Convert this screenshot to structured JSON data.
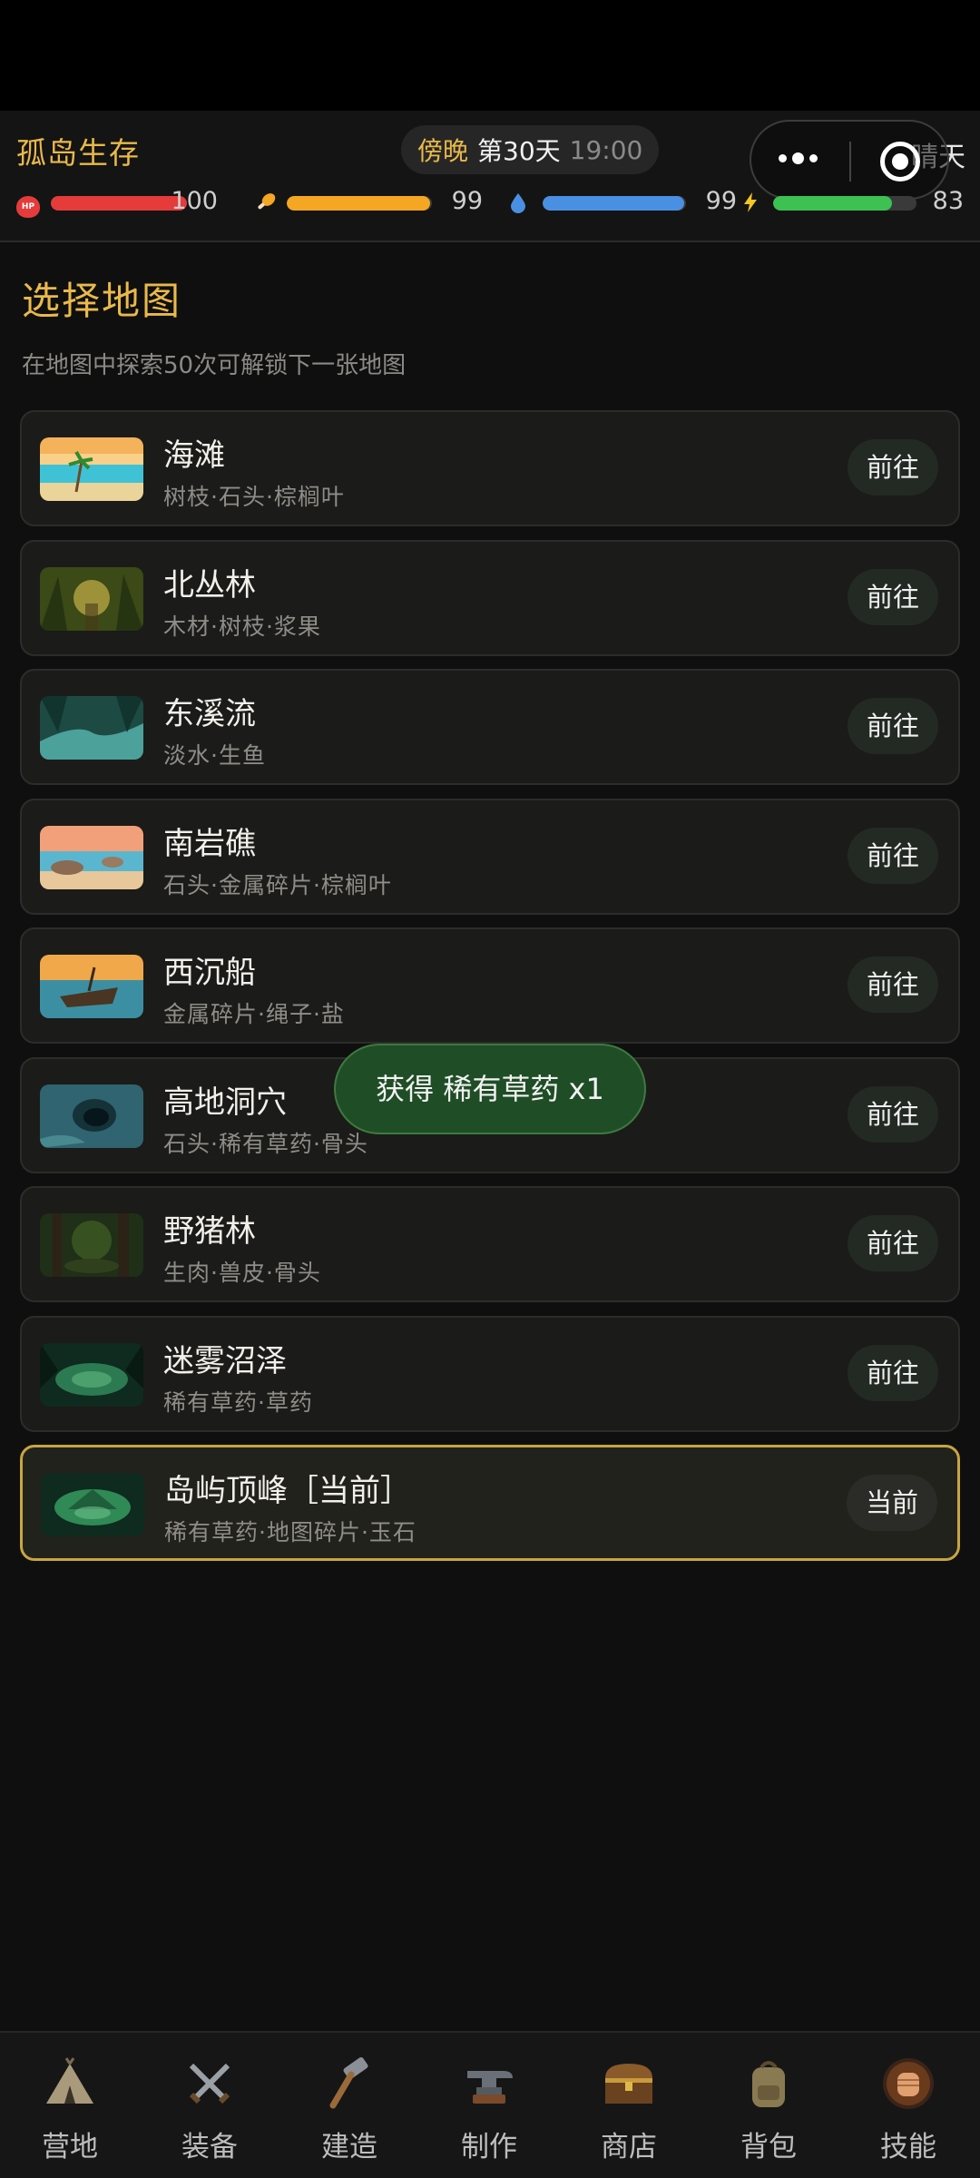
{
  "app": {
    "title": "孤岛生存"
  },
  "time": {
    "period": "傍晚",
    "day": "第30天",
    "clock": "19:00"
  },
  "weather": "晴天",
  "stats": {
    "hp": {
      "icon": "heart-hp-icon",
      "value": 100,
      "max": 100,
      "color": "#e53b3b"
    },
    "hunger": {
      "icon": "drumstick-icon",
      "value": 99,
      "max": 100,
      "color": "#f5a623"
    },
    "thirst": {
      "icon": "water-drop-icon",
      "value": 99,
      "max": 100,
      "color": "#4a90e2"
    },
    "energy": {
      "icon": "lightning-icon",
      "value": 83,
      "max": 100,
      "color": "#3cc152"
    }
  },
  "section": {
    "title": "选择地图",
    "subtitle": "在地图中探索50次可解锁下一张地图"
  },
  "maps": [
    {
      "name": "海滩",
      "resources": "树枝·石头·棕榈叶",
      "button": "前往",
      "thumb": "beach"
    },
    {
      "name": "北丛林",
      "resources": "木材·树枝·浆果",
      "button": "前往",
      "thumb": "jungle"
    },
    {
      "name": "东溪流",
      "resources": "淡水·生鱼",
      "button": "前往",
      "thumb": "stream"
    },
    {
      "name": "南岩礁",
      "resources": "石头·金属碎片·棕榈叶",
      "button": "前往",
      "thumb": "reef"
    },
    {
      "name": "西沉船",
      "resources": "金属碎片·绳子·盐",
      "button": "前往",
      "thumb": "shipwreck"
    },
    {
      "name": "高地洞穴",
      "resources": "石头·稀有草药·骨头",
      "button": "前往",
      "thumb": "cave"
    },
    {
      "name": "野猪林",
      "resources": "生肉·兽皮·骨头",
      "button": "前往",
      "thumb": "boar-forest"
    },
    {
      "name": "迷雾沼泽",
      "resources": "稀有草药·草药",
      "button": "前往",
      "thumb": "swamp"
    },
    {
      "name": "岛屿顶峰［当前］",
      "resources": "稀有草药·地图碎片·玉石",
      "button": "当前",
      "thumb": "peak",
      "current": true
    }
  ],
  "toast": "获得 稀有草药 x1",
  "nav": [
    {
      "label": "营地",
      "icon": "tent-icon"
    },
    {
      "label": "装备",
      "icon": "crossed-swords-icon"
    },
    {
      "label": "建造",
      "icon": "hammer-icon"
    },
    {
      "label": "制作",
      "icon": "anvil-icon"
    },
    {
      "label": "商店",
      "icon": "treasure-chest-icon"
    },
    {
      "label": "背包",
      "icon": "backpack-icon"
    },
    {
      "label": "技能",
      "icon": "fist-icon"
    }
  ],
  "colors": {
    "accent": "#e9b94a",
    "current_border": "#c8a542",
    "toast_bg": "#1f4d26"
  }
}
